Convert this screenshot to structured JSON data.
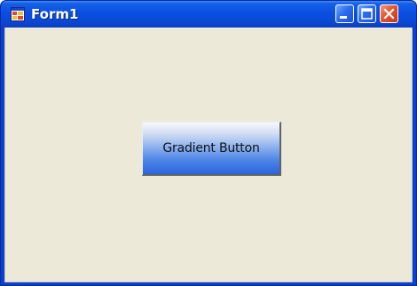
{
  "window": {
    "title": "Form1",
    "icon": "windows-form-icon",
    "controls": {
      "minimize_icon": "minimize-icon",
      "maximize_icon": "maximize-icon",
      "close_icon": "close-icon"
    }
  },
  "client": {
    "background": "#ece9d8",
    "button": {
      "label": "Gradient Button",
      "gradient_colors": [
        "#f7f8fb",
        "#8cb1ee",
        "#2a65dc"
      ]
    }
  },
  "theme": {
    "titlebar_color": "#0a4fe0",
    "close_button_color": "#e5532b"
  }
}
